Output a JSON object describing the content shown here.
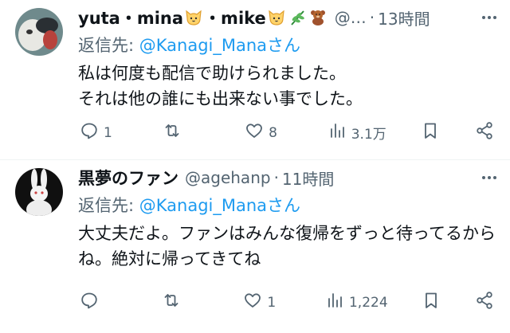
{
  "tweets": [
    {
      "name_parts": [
        "yuta・mina",
        "・mike"
      ],
      "handle": "@…",
      "dot": "·",
      "time": "13時間",
      "reply_prefix": "返信先:",
      "reply_handle": "@Kanagi_Manaさん",
      "text": "私は何度も配信で助けられました。\nそれは他の誰にも出来ない事でした。",
      "replies": "1",
      "retweets": "",
      "likes": "8",
      "views": "3.1万",
      "icons": [
        "cat-face-icon",
        "cat-face-icon",
        "herb-icon",
        "teddy-bear-icon"
      ]
    },
    {
      "name": "黒夢のファン",
      "handle": "@agehanp",
      "dot": "·",
      "time": "11時間",
      "reply_prefix": "返信先:",
      "reply_handle": "@Kanagi_Manaさん",
      "text": "大丈夫だよ。ファンはみんな復帰をずっと待ってるからね。絶対に帰ってきてね",
      "replies": "",
      "retweets": "",
      "likes": "1",
      "views": "1,224"
    }
  ],
  "colors": {
    "accent": "#1d9bf0",
    "muted": "#536471",
    "text": "#0f1419"
  }
}
